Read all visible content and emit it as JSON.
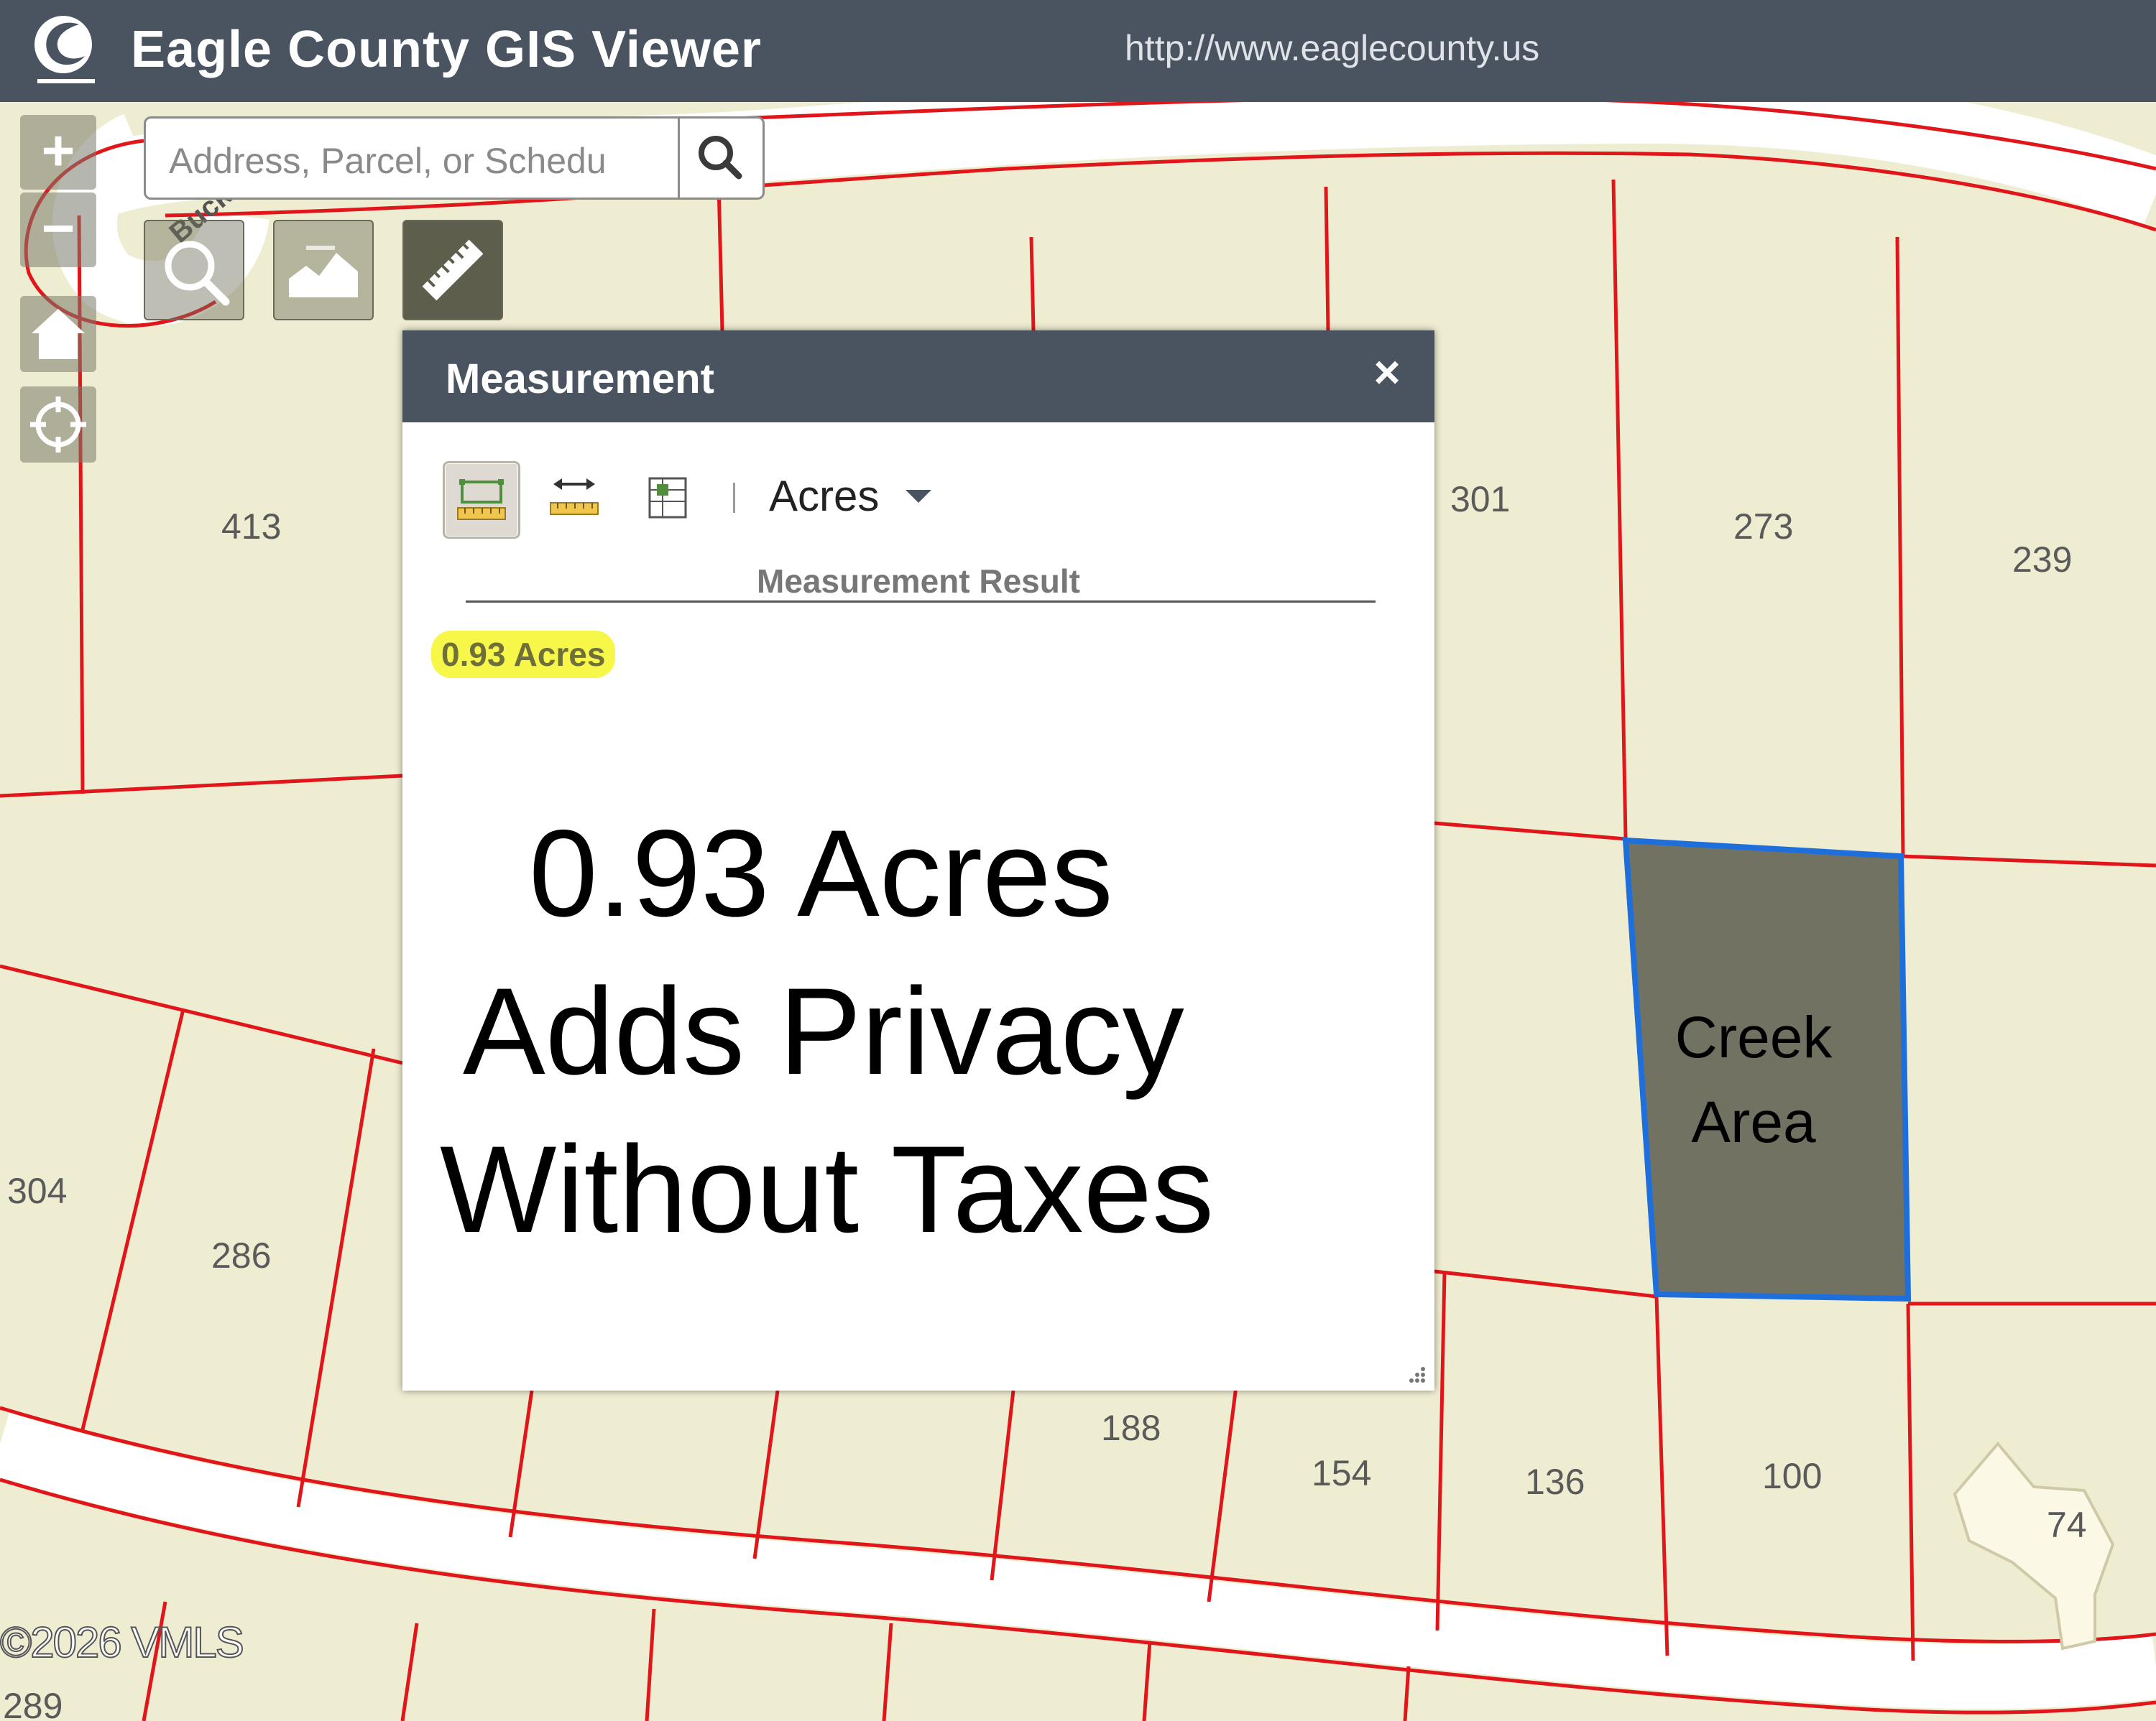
{
  "header": {
    "title": "Eagle County GIS Viewer",
    "url": "http://www.eaglecounty.us"
  },
  "map_controls": {
    "zoom_in_label": "+",
    "zoom_out_label": "−"
  },
  "search": {
    "placeholder": "Address, Parcel, or Schedu"
  },
  "toolbar": {
    "tools": [
      "search-tool",
      "profile-tool",
      "measure-tool"
    ],
    "active_tool": "measure-tool"
  },
  "measurement": {
    "title": "Measurement",
    "close_label": "×",
    "unit": "Acres",
    "result_label": "Measurement Result",
    "result_value": "0.93 Acres"
  },
  "overlay": {
    "line1": "0.93 Acres",
    "line2": "Adds Privacy",
    "line3": "Without Taxes"
  },
  "parcels": {
    "p413": "413",
    "p301": "301",
    "p273": "273",
    "p239": "239",
    "p304": "304",
    "p286": "286",
    "p188": "188",
    "p154": "154",
    "p136": "136",
    "p100": "100",
    "p74": "74",
    "p289": "289"
  },
  "creek_area": {
    "line1": "Creek",
    "line2": "Area"
  },
  "street_label": "Buck",
  "copyright": "©2026 VMLS",
  "colors": {
    "map_background": "#efedd1",
    "parcel_line": "#e1161b",
    "header": "#4a5461",
    "creek_fill": "#727263",
    "creek_outline": "#1e6fdc",
    "highlight": "#f7f74a"
  }
}
